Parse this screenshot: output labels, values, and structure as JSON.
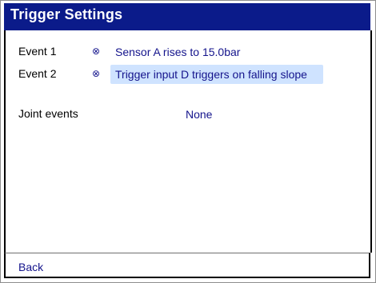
{
  "window": {
    "title": "Trigger Settings"
  },
  "events": [
    {
      "label": "Event 1",
      "status_icon": "crossed-circle-icon",
      "status_glyph": "⊗",
      "value": "Sensor A rises to 15.0bar",
      "selected": false
    },
    {
      "label": "Event 2",
      "status_icon": "crossed-circle-icon",
      "status_glyph": "⊗",
      "value": "Trigger input D triggers on falling slope",
      "selected": true
    }
  ],
  "joint_events": {
    "label": "Joint events",
    "value": "None"
  },
  "footer": {
    "back_label": "Back"
  },
  "colors": {
    "title_bg": "#0b1b8a",
    "accent_text": "#14148c",
    "selected_bg": "#cfe3ff"
  }
}
